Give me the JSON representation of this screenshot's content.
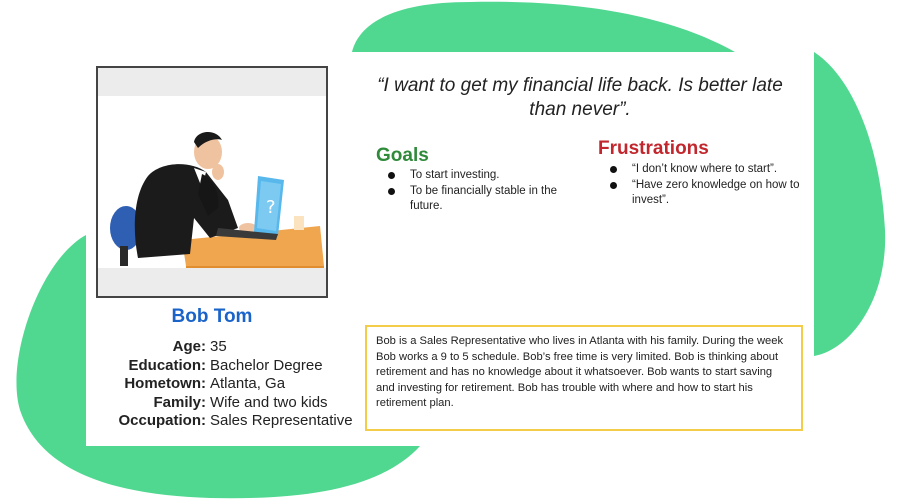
{
  "quote": "“I want to get my financial life back. Is better late than never”.",
  "persona": {
    "name": "Bob Tom",
    "fields": [
      {
        "label": "Age:",
        "value": "35"
      },
      {
        "label": "Education:",
        "value": "Bachelor Degree"
      },
      {
        "label": "Hometown:",
        "value": "Atlanta, Ga"
      },
      {
        "label": "Family:",
        "value": "Wife and two kids"
      },
      {
        "label": "Occupation:",
        "value": "Sales Representative"
      }
    ]
  },
  "goals": {
    "title": "Goals",
    "items": [
      "To start investing.",
      "To be financially stable in the future."
    ]
  },
  "frustrations": {
    "title": "Frustrations",
    "items": [
      "“I don’t know where to start”.",
      "“Have zero knowledge on how to invest”."
    ]
  },
  "bio": "Bob is a Sales Representative who lives in Atlanta with his family. During the week Bob works a 9 to 5 schedule. Bob’s free time is very limited. Bob is thinking about retirement and has no knowledge about it whatsoever. Bob wants to start saving and investing for retirement. Bob has trouble with where and how to start his retirement plan.",
  "colors": {
    "blob": "#50d890",
    "name": "#1a63c9",
    "goals": "#2f8a3a",
    "frustrations": "#c1272d",
    "bio_border": "#f3cc4a"
  },
  "illustration": "man-at-laptop-illustration"
}
